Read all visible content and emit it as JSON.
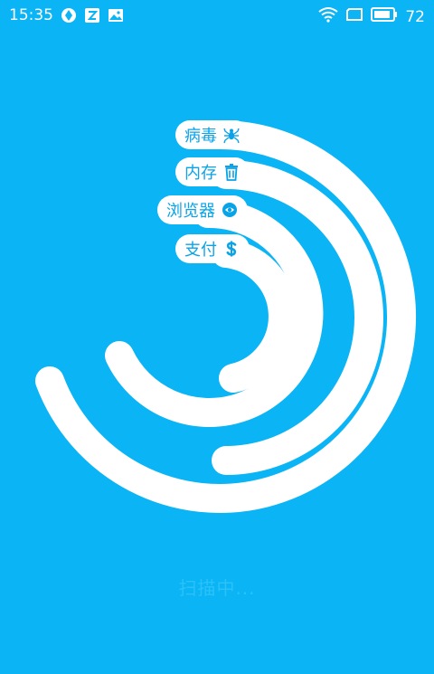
{
  "status_bar": {
    "time": "15:35",
    "battery": "72",
    "left_icons": [
      "sync-icon",
      "notification-icon",
      "gallery-icon"
    ],
    "right_icons": [
      "wifi-icon",
      "screen-icon",
      "battery-icon"
    ]
  },
  "categories": [
    {
      "label": "病毒",
      "icon": "spider-icon"
    },
    {
      "label": "内存",
      "icon": "trash-icon"
    },
    {
      "label": "浏览器",
      "icon": "browser-icon"
    },
    {
      "label": "支付",
      "icon": "dollar-icon"
    }
  ],
  "scan_status": "扫描中..."
}
